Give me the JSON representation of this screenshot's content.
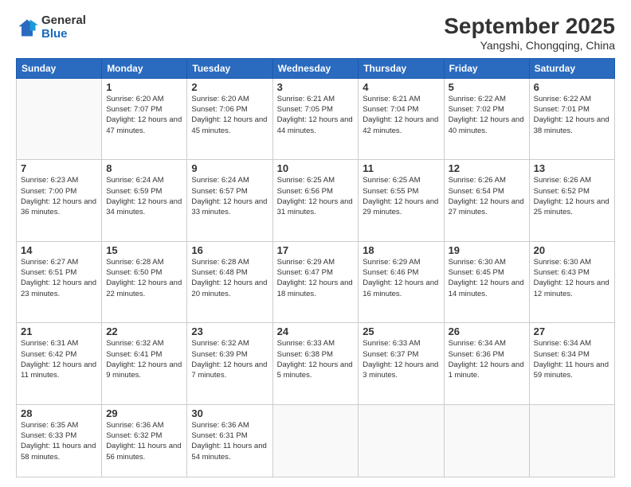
{
  "logo": {
    "general": "General",
    "blue": "Blue"
  },
  "header": {
    "title": "September 2025",
    "subtitle": "Yangshi, Chongqing, China"
  },
  "weekdays": [
    "Sunday",
    "Monday",
    "Tuesday",
    "Wednesday",
    "Thursday",
    "Friday",
    "Saturday"
  ],
  "weeks": [
    [
      {
        "day": "",
        "info": ""
      },
      {
        "day": "1",
        "info": "Sunrise: 6:20 AM\nSunset: 7:07 PM\nDaylight: 12 hours and 47 minutes."
      },
      {
        "day": "2",
        "info": "Sunrise: 6:20 AM\nSunset: 7:06 PM\nDaylight: 12 hours and 45 minutes."
      },
      {
        "day": "3",
        "info": "Sunrise: 6:21 AM\nSunset: 7:05 PM\nDaylight: 12 hours and 44 minutes."
      },
      {
        "day": "4",
        "info": "Sunrise: 6:21 AM\nSunset: 7:04 PM\nDaylight: 12 hours and 42 minutes."
      },
      {
        "day": "5",
        "info": "Sunrise: 6:22 AM\nSunset: 7:02 PM\nDaylight: 12 hours and 40 minutes."
      },
      {
        "day": "6",
        "info": "Sunrise: 6:22 AM\nSunset: 7:01 PM\nDaylight: 12 hours and 38 minutes."
      }
    ],
    [
      {
        "day": "7",
        "info": "Sunrise: 6:23 AM\nSunset: 7:00 PM\nDaylight: 12 hours and 36 minutes."
      },
      {
        "day": "8",
        "info": "Sunrise: 6:24 AM\nSunset: 6:59 PM\nDaylight: 12 hours and 34 minutes."
      },
      {
        "day": "9",
        "info": "Sunrise: 6:24 AM\nSunset: 6:57 PM\nDaylight: 12 hours and 33 minutes."
      },
      {
        "day": "10",
        "info": "Sunrise: 6:25 AM\nSunset: 6:56 PM\nDaylight: 12 hours and 31 minutes."
      },
      {
        "day": "11",
        "info": "Sunrise: 6:25 AM\nSunset: 6:55 PM\nDaylight: 12 hours and 29 minutes."
      },
      {
        "day": "12",
        "info": "Sunrise: 6:26 AM\nSunset: 6:54 PM\nDaylight: 12 hours and 27 minutes."
      },
      {
        "day": "13",
        "info": "Sunrise: 6:26 AM\nSunset: 6:52 PM\nDaylight: 12 hours and 25 minutes."
      }
    ],
    [
      {
        "day": "14",
        "info": "Sunrise: 6:27 AM\nSunset: 6:51 PM\nDaylight: 12 hours and 23 minutes."
      },
      {
        "day": "15",
        "info": "Sunrise: 6:28 AM\nSunset: 6:50 PM\nDaylight: 12 hours and 22 minutes."
      },
      {
        "day": "16",
        "info": "Sunrise: 6:28 AM\nSunset: 6:48 PM\nDaylight: 12 hours and 20 minutes."
      },
      {
        "day": "17",
        "info": "Sunrise: 6:29 AM\nSunset: 6:47 PM\nDaylight: 12 hours and 18 minutes."
      },
      {
        "day": "18",
        "info": "Sunrise: 6:29 AM\nSunset: 6:46 PM\nDaylight: 12 hours and 16 minutes."
      },
      {
        "day": "19",
        "info": "Sunrise: 6:30 AM\nSunset: 6:45 PM\nDaylight: 12 hours and 14 minutes."
      },
      {
        "day": "20",
        "info": "Sunrise: 6:30 AM\nSunset: 6:43 PM\nDaylight: 12 hours and 12 minutes."
      }
    ],
    [
      {
        "day": "21",
        "info": "Sunrise: 6:31 AM\nSunset: 6:42 PM\nDaylight: 12 hours and 11 minutes."
      },
      {
        "day": "22",
        "info": "Sunrise: 6:32 AM\nSunset: 6:41 PM\nDaylight: 12 hours and 9 minutes."
      },
      {
        "day": "23",
        "info": "Sunrise: 6:32 AM\nSunset: 6:39 PM\nDaylight: 12 hours and 7 minutes."
      },
      {
        "day": "24",
        "info": "Sunrise: 6:33 AM\nSunset: 6:38 PM\nDaylight: 12 hours and 5 minutes."
      },
      {
        "day": "25",
        "info": "Sunrise: 6:33 AM\nSunset: 6:37 PM\nDaylight: 12 hours and 3 minutes."
      },
      {
        "day": "26",
        "info": "Sunrise: 6:34 AM\nSunset: 6:36 PM\nDaylight: 12 hours and 1 minute."
      },
      {
        "day": "27",
        "info": "Sunrise: 6:34 AM\nSunset: 6:34 PM\nDaylight: 11 hours and 59 minutes."
      }
    ],
    [
      {
        "day": "28",
        "info": "Sunrise: 6:35 AM\nSunset: 6:33 PM\nDaylight: 11 hours and 58 minutes."
      },
      {
        "day": "29",
        "info": "Sunrise: 6:36 AM\nSunset: 6:32 PM\nDaylight: 11 hours and 56 minutes."
      },
      {
        "day": "30",
        "info": "Sunrise: 6:36 AM\nSunset: 6:31 PM\nDaylight: 11 hours and 54 minutes."
      },
      {
        "day": "",
        "info": ""
      },
      {
        "day": "",
        "info": ""
      },
      {
        "day": "",
        "info": ""
      },
      {
        "day": "",
        "info": ""
      }
    ]
  ]
}
